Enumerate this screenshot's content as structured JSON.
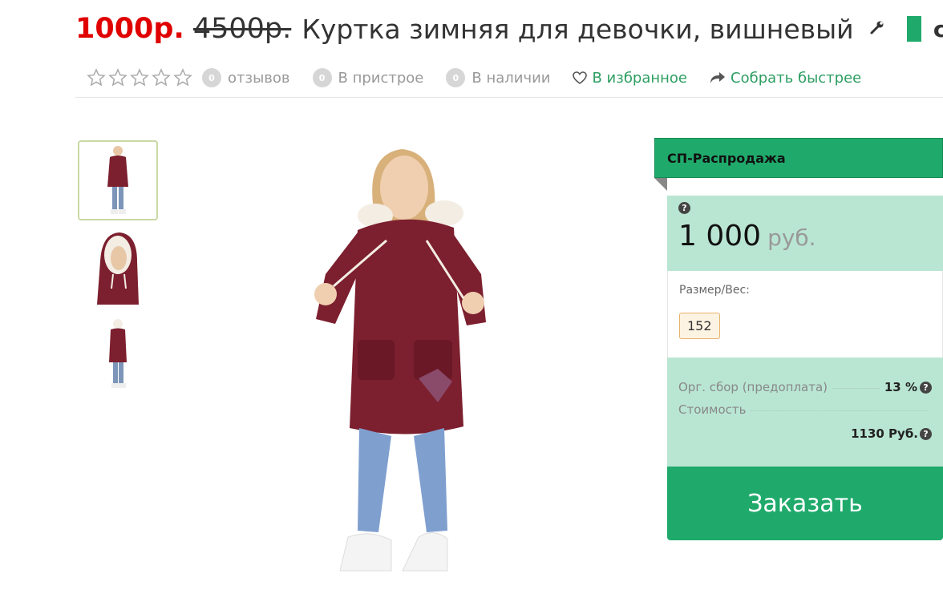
{
  "product": {
    "price_new": "1000р.",
    "price_old": "4500р.",
    "title": "Куртка зимняя для девочки, вишневый",
    "tag_label": "cr"
  },
  "meta": {
    "rating_stars": 0,
    "reviews_count": "0",
    "reviews_label": "отзывов",
    "attach_count": "0",
    "attach_label": "В пристрое",
    "stock_count": "0",
    "stock_label": "В наличии",
    "favorite_label": "В избранное",
    "share_label": "Собрать быстрее"
  },
  "panel": {
    "header": "СП-Распродажа",
    "help_icon": "?",
    "price_value": "1 000",
    "price_currency": "руб.",
    "size_label": "Размер/Вес:",
    "size_option": "152",
    "fee_label": "Орг. сбор (предоплата)",
    "fee_value": "13 %",
    "cost_label": "Стоимость",
    "cost_value": "1130 Руб.",
    "order_label": "Заказать"
  },
  "colors": {
    "accent_green": "#1faa6b",
    "price_red": "#e00000",
    "panel_mint": "#b9e6d3",
    "jacket_burgundy": "#7c1f2e"
  },
  "icons": [
    "wrench-icon",
    "star-outline-icon",
    "heart-outline-icon",
    "share-arrow-icon",
    "question-circle-icon"
  ]
}
